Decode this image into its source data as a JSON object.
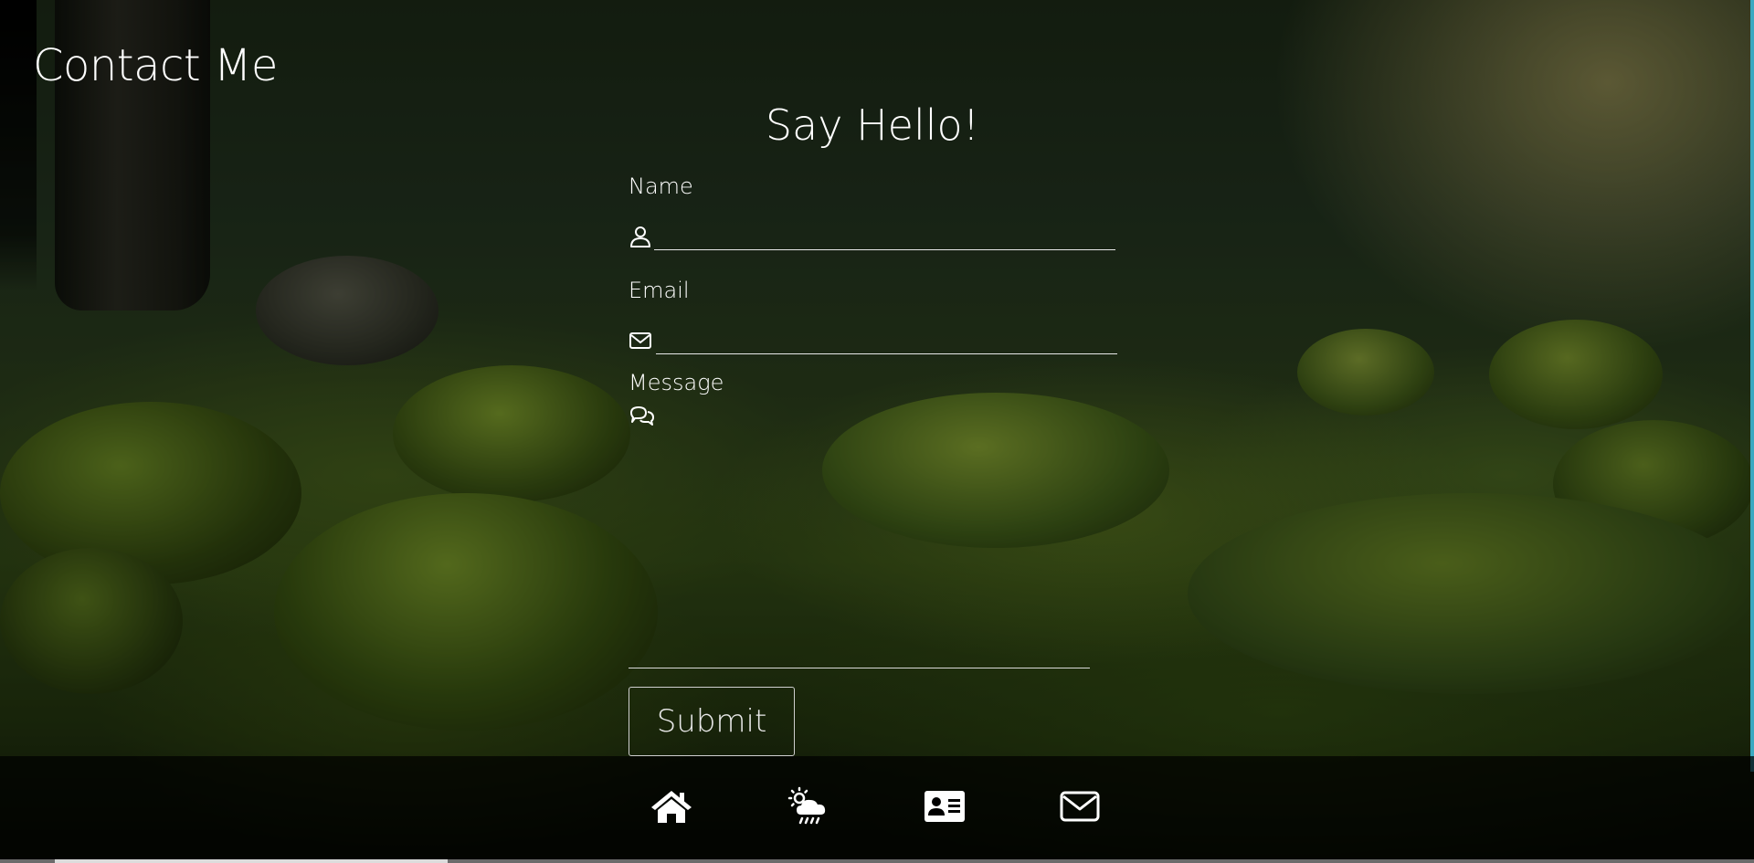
{
  "page": {
    "title": "Contact Me"
  },
  "form": {
    "heading": "Say Hello!",
    "name": {
      "label": "Name",
      "icon": "user-icon",
      "value": "",
      "placeholder": ""
    },
    "email": {
      "label": "Email",
      "icon": "envelope-icon",
      "value": "",
      "placeholder": ""
    },
    "message": {
      "label": "Message",
      "icon": "chat-icon",
      "value": "",
      "placeholder": ""
    },
    "submit_label": "Submit"
  },
  "footer_nav": {
    "items": [
      {
        "icon": "home-icon"
      },
      {
        "icon": "weather-icon"
      },
      {
        "icon": "contact-card-icon"
      },
      {
        "icon": "mail-icon"
      }
    ]
  },
  "colors": {
    "text": "#ffffff",
    "footer_background": "#000000",
    "right_edge_accent": "#3aa8c0"
  }
}
